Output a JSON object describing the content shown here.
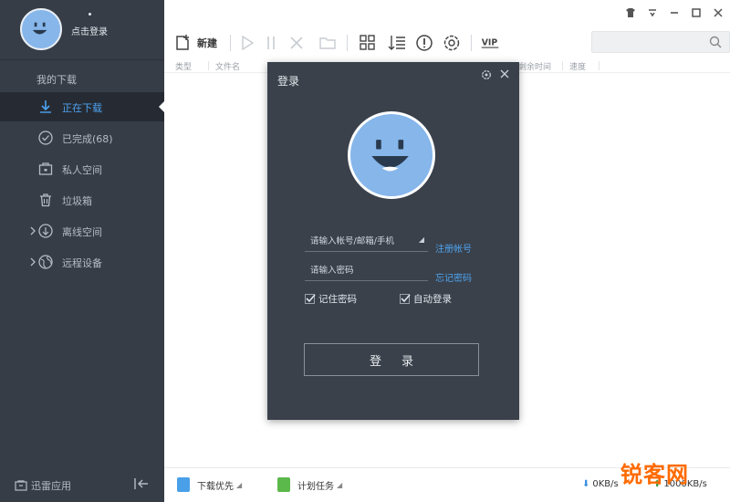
{
  "sidebar": {
    "login_link": "点击登录",
    "section_title": "我的下载",
    "items": [
      {
        "label": "正在下载"
      },
      {
        "label": "已完成(68)"
      },
      {
        "label": "私人空间"
      },
      {
        "label": "垃圾箱"
      },
      {
        "label": "离线空间"
      },
      {
        "label": "远程设备"
      }
    ],
    "apps_label": "迅雷应用"
  },
  "toolbar": {
    "new_label": "新建",
    "vip_label": "VIP",
    "search_placeholder": ""
  },
  "columns": [
    "类型",
    "文件名",
    "剩余时间",
    "速度"
  ],
  "dialog": {
    "title": "登录",
    "account_placeholder": "请输入帐号/邮箱/手机",
    "password_placeholder": "请输入密码",
    "register_link": "注册帐号",
    "forgot_link": "忘记密码",
    "remember_label": "记住密码",
    "remember_checked": true,
    "autologin_label": "自动登录",
    "autologin_checked": true,
    "submit_label": "登录"
  },
  "statusbar": {
    "priority_label": "下载优先",
    "schedule_label": "计划任务",
    "down_speed": "0KB/s",
    "up_speed": "1000KB/s"
  },
  "watermark": "锐客网",
  "colors": {
    "sidebar_bg": "#363d47",
    "accent": "#4ea3f2",
    "dialog_bg": "#3a414b",
    "avatar": "#86b6ea"
  }
}
